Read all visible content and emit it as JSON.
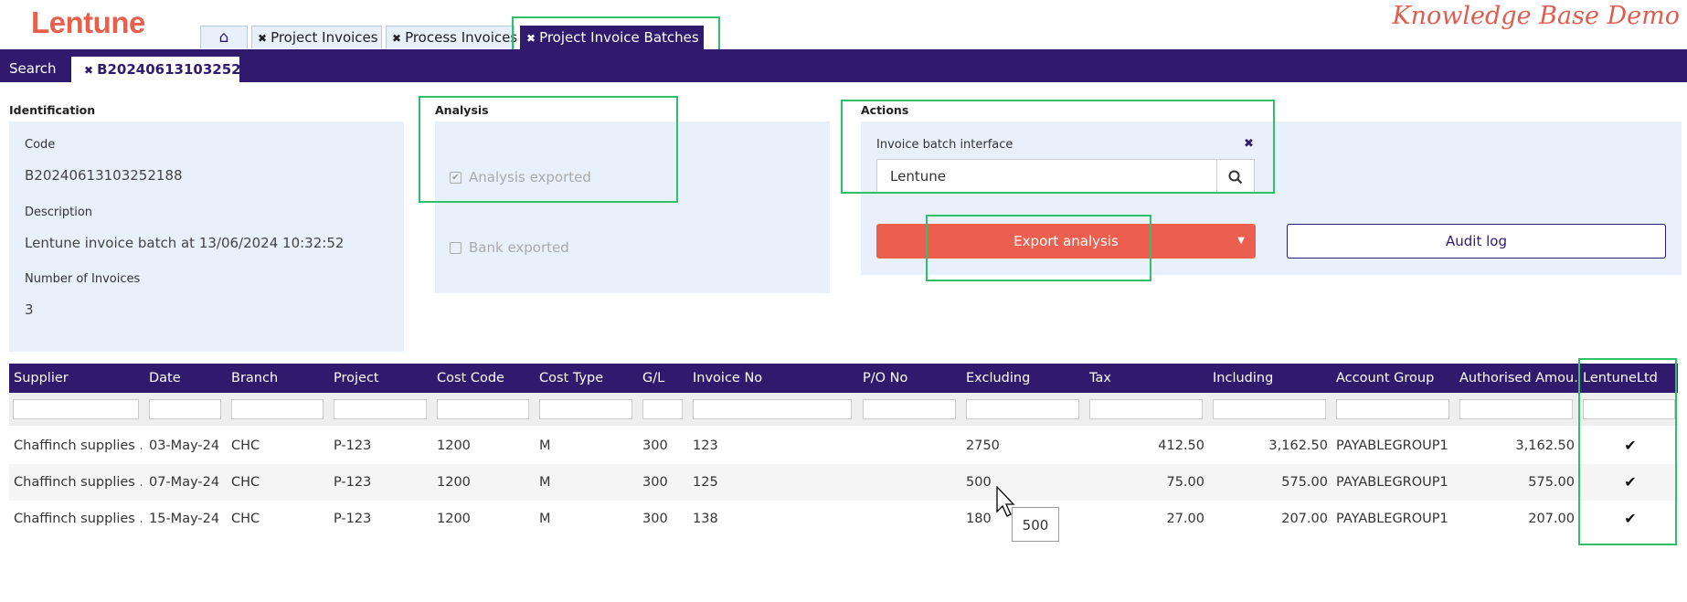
{
  "app": {
    "logo": "Lentune",
    "banner": "Knowledge Base Demo"
  },
  "tabs": [
    {
      "label": "Project Invoices"
    },
    {
      "label": "Process Invoices"
    },
    {
      "label": "Project Invoice Batches",
      "active": true
    }
  ],
  "nav": {
    "search_label": "Search",
    "record_tab": "B20240613103252"
  },
  "identification": {
    "title": "Identification",
    "code_label": "Code",
    "code_value": "B20240613103252188",
    "desc_label": "Description",
    "desc_value": "Lentune invoice batch at 13/06/2024 10:32:52",
    "count_label": "Number of Invoices",
    "count_value": "3"
  },
  "analysis": {
    "title": "Analysis",
    "analysis_exported": "Analysis exported",
    "analysis_checked": true,
    "bank_exported": "Bank exported",
    "bank_checked": false
  },
  "actions": {
    "title": "Actions",
    "interface_label": "Invoice batch interface",
    "interface_value": "Lentune",
    "export_button": "Export analysis",
    "audit_button": "Audit log"
  },
  "grid": {
    "columns": [
      "Supplier",
      "Date",
      "Branch",
      "Project",
      "Cost Code",
      "Cost Type",
      "G/L",
      "Invoice No",
      "P/O No",
      "Excluding",
      "Tax",
      "Including",
      "Account Group",
      "Authorised Amou...",
      "LentuneLtd"
    ],
    "rows": [
      [
        "Chaffinch supplies ...",
        "03-May-24",
        "CHC",
        "P-123",
        "1200",
        "M",
        "300",
        "123",
        "",
        "2750",
        "412.50",
        "3,162.50",
        "PAYABLEGROUP1",
        "3,162.50",
        "✔"
      ],
      [
        "Chaffinch supplies ...",
        "07-May-24",
        "CHC",
        "P-123",
        "1200",
        "M",
        "300",
        "125",
        "",
        "500",
        "75.00",
        "575.00",
        "PAYABLEGROUP1",
        "575.00",
        "✔"
      ],
      [
        "Chaffinch supplies ...",
        "15-May-24",
        "CHC",
        "P-123",
        "1200",
        "M",
        "300",
        "138",
        "",
        "180",
        "27.00",
        "207.00",
        "PAYABLEGROUP1",
        "207.00",
        "✔"
      ]
    ]
  },
  "tooltip": "500",
  "colors": {
    "brand": "#2f1a6e",
    "accent": "#ec5f4e",
    "panel": "#e7f0fb",
    "highlight": "#2ec06b"
  },
  "icons": {
    "home": "home-icon",
    "search": "search-icon",
    "close": "close-icon",
    "check": "check-icon"
  }
}
